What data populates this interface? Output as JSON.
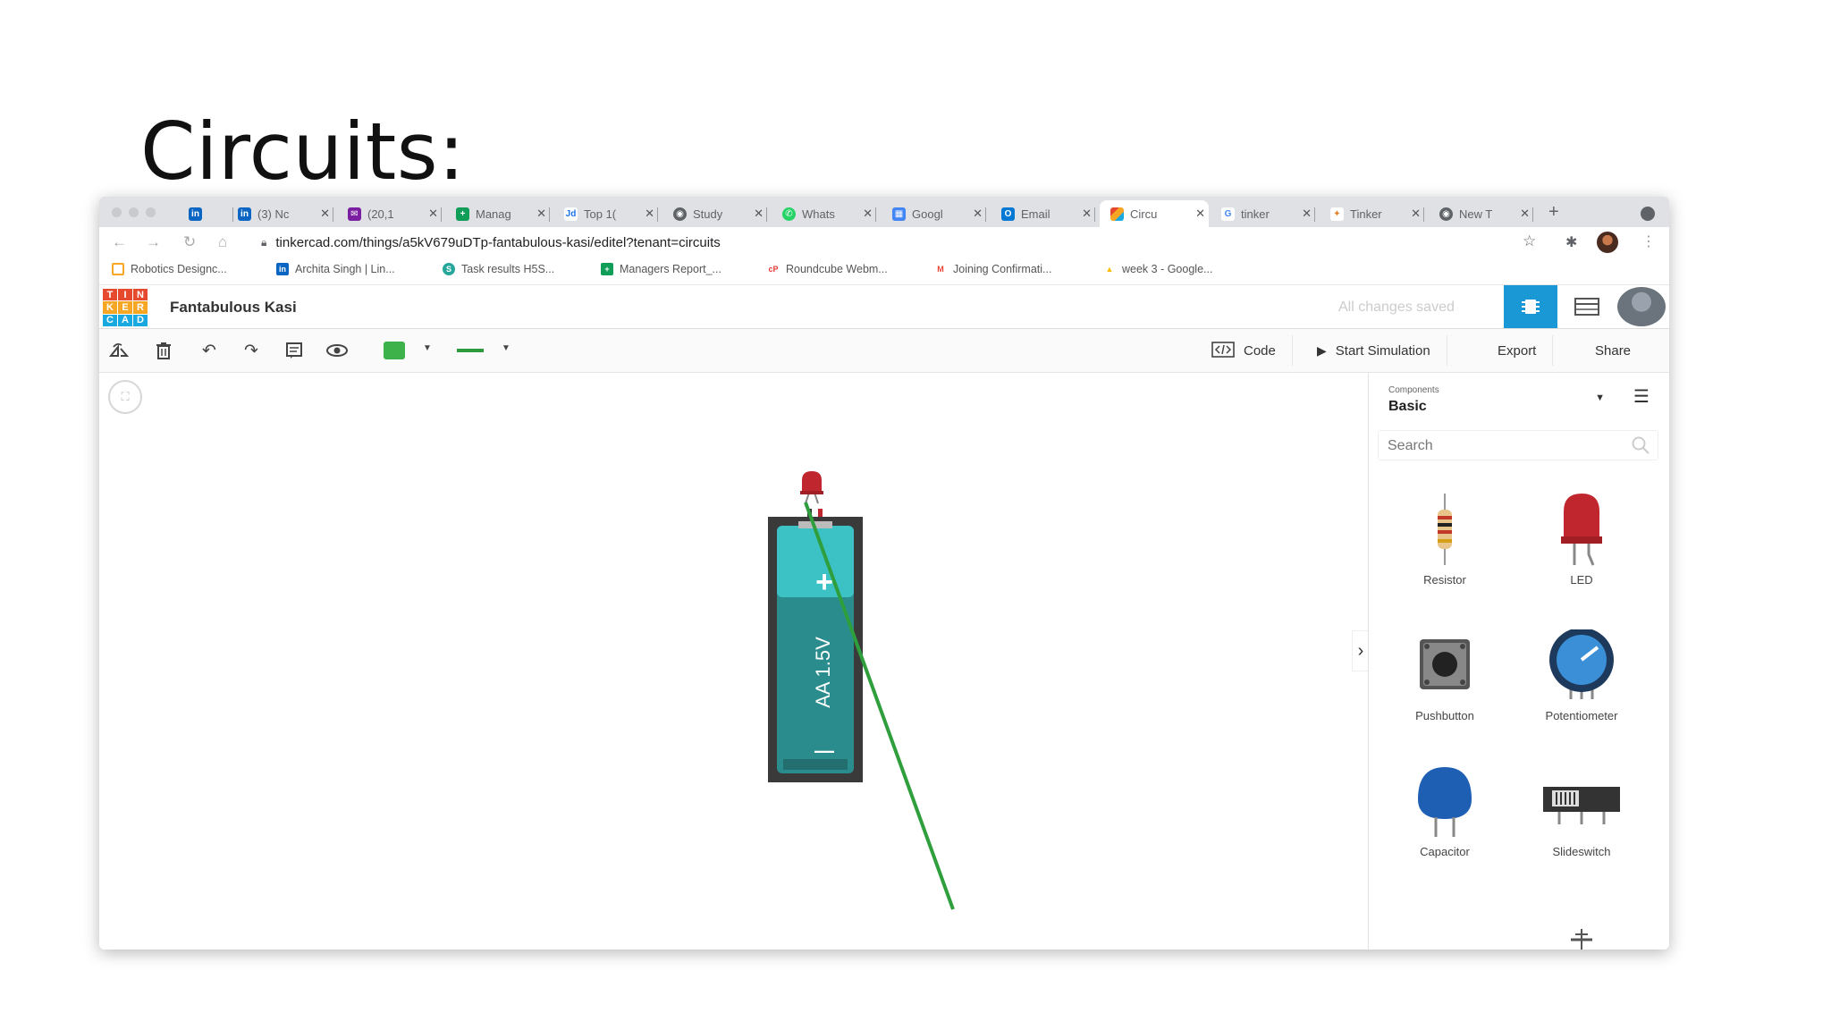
{
  "slide": {
    "title": "Circuits:"
  },
  "browser": {
    "tabs": [
      {
        "title": "",
        "icon": "linkedin-icon",
        "color": "#0a66c2",
        "glyph": "in"
      },
      {
        "title": "(3) Nc",
        "icon": "linkedin-icon",
        "color": "#0a66c2",
        "glyph": "in"
      },
      {
        "title": "(20,1",
        "icon": "mail-icon",
        "color": "#7b1fa2",
        "glyph": "✉"
      },
      {
        "title": "Manag",
        "icon": "sheets-icon",
        "color": "#0f9d58",
        "glyph": "+"
      },
      {
        "title": "Top 1(",
        "icon": "jd-icon",
        "color": "#1a73e8",
        "glyph": "Jd"
      },
      {
        "title": "Study",
        "icon": "globe-icon",
        "color": "#5f6368",
        "glyph": "◉"
      },
      {
        "title": "Whats",
        "icon": "whatsapp-icon",
        "color": "#25d366",
        "glyph": "✆"
      },
      {
        "title": "Googl",
        "icon": "calendar-icon",
        "color": "#4285f4",
        "glyph": "▦"
      },
      {
        "title": "Email",
        "icon": "outlook-icon",
        "color": "#0078d4",
        "glyph": "O"
      },
      {
        "title": "Circu",
        "icon": "tinkercad-icon",
        "color": "#e64a2e",
        "glyph": "▦"
      },
      {
        "title": "tinker",
        "icon": "google-icon",
        "color": "#4285f4",
        "glyph": "G"
      },
      {
        "title": "Tinker",
        "icon": "tinker-icon",
        "color": "#e67e22",
        "glyph": "✦"
      },
      {
        "title": "New T",
        "icon": "chrome-icon",
        "color": "#5f6368",
        "glyph": "◉"
      }
    ],
    "url": "tinkercad.com/things/a5kV679uDTp-fantabulous-kasi/editel?tenant=circuits",
    "bookmarks": [
      {
        "label": "Robotics Designc...",
        "color": "#f9a825",
        "glyph": "▭"
      },
      {
        "label": "Archita Singh | Lin...",
        "color": "#0a66c2",
        "glyph": "in"
      },
      {
        "label": "Task results H5S...",
        "color": "#26a69a",
        "glyph": "S"
      },
      {
        "label": "Managers Report_...",
        "color": "#0f9d58",
        "glyph": "+"
      },
      {
        "label": "Roundcube Webm...",
        "color": "#e53935",
        "glyph": "cP"
      },
      {
        "label": "Joining Confirmati...",
        "color": "#ea4335",
        "glyph": "M"
      },
      {
        "label": "week 3 - Google...",
        "color": "#fbbc04",
        "glyph": "▲"
      }
    ]
  },
  "tinkercad": {
    "logo": [
      "T",
      "I",
      "N",
      "K",
      "E",
      "R",
      "C",
      "A",
      "D"
    ],
    "logo_colors": [
      "#e64a2e",
      "#e64a2e",
      "#e64a2e",
      "#f6a623",
      "#f6a623",
      "#f6a623",
      "#1aa8e1",
      "#1aa8e1",
      "#1aa8e1"
    ],
    "project_title": "Fantabulous Kasi",
    "save_status": "All changes saved",
    "toolbar": {
      "code": "Code",
      "start_simulation": "Start Simulation",
      "export": "Export",
      "share": "Share"
    },
    "wire_color": "#3db24a",
    "panel": {
      "components_label": "Components",
      "components_value": "Basic",
      "search_placeholder": "Search",
      "components": [
        {
          "name": "Resistor"
        },
        {
          "name": "LED"
        },
        {
          "name": "Pushbutton"
        },
        {
          "name": "Potentiometer"
        },
        {
          "name": "Capacitor"
        },
        {
          "name": "Slideswitch"
        }
      ]
    },
    "canvas": {
      "battery_label": "AA 1.5V",
      "battery_plus": "+",
      "battery_minus": "—"
    }
  }
}
